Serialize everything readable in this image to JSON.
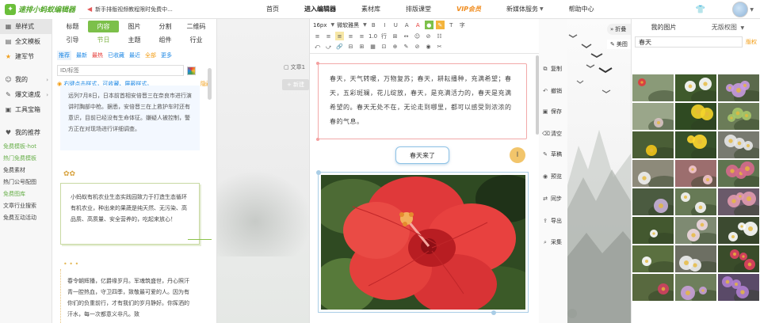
{
  "topbar": {
    "logo": "速排小蚂蚁编辑器",
    "notice": "新手排版视频教程限时免费中...",
    "nav": [
      "首页",
      "进入编辑器",
      "素材库",
      "排版课堂",
      "VIP会员",
      "新媒体服务",
      "帮助中心"
    ]
  },
  "leftnav": {
    "items": [
      "单样式",
      "全文模板",
      "建军节"
    ],
    "sections": [
      "我的",
      "爆文速成",
      "工具宝箱",
      "我的推荐"
    ],
    "links": [
      "免费模板-hot",
      "热门免费模板",
      "免费素材",
      "热门公号配图",
      "免费图库",
      "文章行业搜索",
      "免费互动活动"
    ]
  },
  "material": {
    "categories": [
      "标题",
      "内容",
      "图片",
      "分割",
      "二维码",
      "引导",
      "节日",
      "主题",
      "组件",
      "行业"
    ],
    "filters": [
      "推荐",
      "最新",
      "最热",
      "已收藏",
      "最近",
      "全部",
      "更多"
    ],
    "search_placeholder": "ID/标签",
    "tip": "右键点击样式，可收藏、屏蔽样式。",
    "tip_action": "隐藏",
    "card1": "远列7月8日，日本前首相安倍晋三在奈良市进行演讲时胸部中枪。据悉，安倍晋三在上救护车时还有意识，目前已经没有生命体征。嫌疑人被控制，警方正在对现场进行详细调查。",
    "card2": "小蚂蚁有机农业生态实践园致力于打造生态循环有机农业，种出来的果蔬是纯天然、无污染、高品质、高质量、安全营养的，吃起来放心！",
    "card3": "春令朝辉播，亿爵缘岁月。军魂筑盛世，丹心照汗青一腔热血，守卫四季，致敬最可爱的人。因为有你们的负重前行，才有我们的岁月静好。你挥洒的汗水，每一次都意义非凡。致"
  },
  "workspace": {
    "doc_label": "文章1",
    "new_label": "+ 新建"
  },
  "toolbar": {
    "font_size": "16px",
    "font_family": "微软雅黑",
    "line1": [
      "B",
      "I",
      "U",
      "A",
      "A",
      "颜色",
      "格式刷",
      "T",
      "字"
    ],
    "line2": [
      "≡",
      "≡",
      "≡",
      "≡",
      "≡",
      "1.0",
      "行",
      "⊞",
      "↔",
      "☺",
      "⊘",
      "☷"
    ],
    "line3": [
      "⤺",
      "⤻",
      "🔗",
      "⊟",
      "⊞",
      "▦",
      "⊡",
      "⊕",
      "✎",
      "⊘",
      "◉",
      "✂"
    ]
  },
  "editor": {
    "body": "春天，天气转暖，万物复苏；春天，耕耘播种，充满希望；春天，五彩斑斓，花儿绽放，春天，是充满活力的，春天是充满希望的。春天无处不在，无论走到哪里，都可以感受到浓浓的春的气息。",
    "title": "春天来了"
  },
  "actions": [
    "复制",
    "撤销",
    "保存",
    "清空",
    "草稿",
    "预览",
    "同步",
    "导出",
    "采集"
  ],
  "scenery": {
    "fold": "折叠",
    "preview": "美图"
  },
  "gallery": {
    "tab_mine": "我的图片",
    "tab_copyright": "无版权图",
    "search_value": "春天",
    "search_more": "版权"
  },
  "colors": {
    "brand_green": "#7cc04a",
    "accent_orange": "#f39c12",
    "link_blue": "#1e88e5",
    "text_border": "#f2a9a9",
    "title_border": "#8fc3e6"
  }
}
